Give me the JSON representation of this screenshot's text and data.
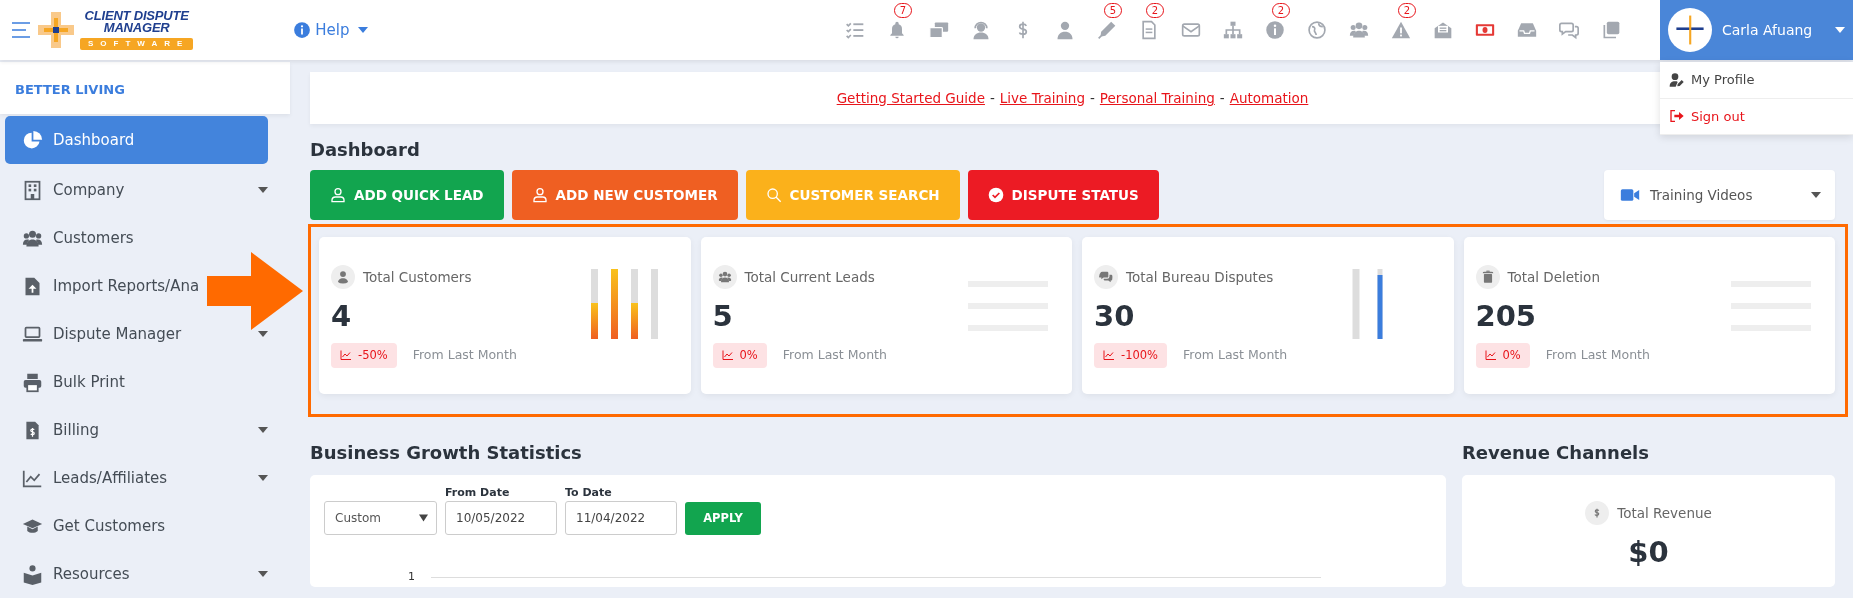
{
  "logo": {
    "lines": [
      "CLIENT DISPUTE",
      "MANAGER"
    ],
    "tagline": "SOFTWARE"
  },
  "help": {
    "label": "Help"
  },
  "toolbar": [
    {
      "kind": "plain"
    },
    {
      "kind": "badged",
      "badge": "7"
    },
    {
      "kind": "plain"
    },
    {
      "kind": "plain"
    },
    {
      "kind": "plain"
    },
    {
      "kind": "plain"
    },
    {
      "kind": "badged",
      "badge": "5"
    },
    {
      "kind": "badged",
      "badge": "2"
    },
    {
      "kind": "plain"
    },
    {
      "kind": "plain"
    },
    {
      "kind": "badged",
      "badge": "2"
    },
    {
      "kind": "plain"
    },
    {
      "kind": "plain"
    },
    {
      "kind": "badged",
      "badge": "2"
    },
    {
      "kind": "plain"
    },
    {
      "kind": "plain"
    },
    {
      "kind": "plain"
    },
    {
      "kind": "plain"
    },
    {
      "kind": "plain"
    }
  ],
  "user": {
    "name": "Carla Afuang",
    "menu": [
      {
        "kind": "profile",
        "label": "My Profile"
      },
      {
        "kind": "signout",
        "label": "Sign out"
      }
    ]
  },
  "sidebar": {
    "company": "BETTER LIVING",
    "items": [
      {
        "label": "Dashboard",
        "caret": false,
        "selected": true
      },
      {
        "label": "Company",
        "caret": true,
        "selected": false
      },
      {
        "label": "Customers",
        "caret": false,
        "selected": false
      },
      {
        "label": "Import Reports/Ana",
        "caret": false,
        "selected": false
      },
      {
        "label": "Dispute Manager",
        "caret": true,
        "selected": false
      },
      {
        "label": "Bulk Print",
        "caret": false,
        "selected": false
      },
      {
        "label": "Billing",
        "caret": true,
        "selected": false
      },
      {
        "label": "Leads/Affiliates",
        "caret": true,
        "selected": false
      },
      {
        "label": "Get Customers",
        "caret": false,
        "selected": false
      },
      {
        "label": "Resources",
        "caret": true,
        "selected": false
      }
    ]
  },
  "banner": [
    {
      "kind": "link",
      "text": "Getting Started Guide"
    },
    {
      "kind": "sep",
      "text": "-"
    },
    {
      "kind": "link",
      "text": "Live Training"
    },
    {
      "kind": "sep",
      "text": "-"
    },
    {
      "kind": "link",
      "text": "Personal Training"
    },
    {
      "kind": "sep",
      "text": "-"
    },
    {
      "kind": "link",
      "text": "Automation"
    }
  ],
  "page_title": "Dashboard",
  "actions": [
    {
      "label": "ADD QUICK LEAD",
      "color": "#12a54f"
    },
    {
      "label": "ADD NEW CUSTOMER",
      "color": "#ef5f22"
    },
    {
      "label": "CUSTOMER SEARCH",
      "color": "#fbb11b"
    },
    {
      "label": "DISPUTE STATUS",
      "color": "#ec1b24"
    }
  ],
  "training_select": {
    "label": "Training Videos"
  },
  "annotations": {
    "arrow": true,
    "highlight_stats": true
  },
  "stats": [
    {
      "title": "Total Customers",
      "value": "4",
      "change": "-50%",
      "note": "From Last Month"
    },
    {
      "title": "Total Current Leads",
      "value": "5",
      "change": "0%",
      "note": "From Last Month"
    },
    {
      "title": "Total Bureau Disputes",
      "value": "30",
      "change": "-100%",
      "note": "From Last Month"
    },
    {
      "title": "Total Deletion",
      "value": "205",
      "change": "0%",
      "note": "From Last Month"
    }
  ],
  "growth": {
    "title": "Business Growth Statistics",
    "range": "Custom",
    "from": {
      "label": "From Date",
      "value": "10/05/2022"
    },
    "to": {
      "label": "To Date",
      "value": "11/04/2022"
    },
    "apply": "APPLY",
    "y_tick": "1"
  },
  "revenue": {
    "title": "Revenue Channels",
    "label": "Total Revenue",
    "value": "$0"
  }
}
